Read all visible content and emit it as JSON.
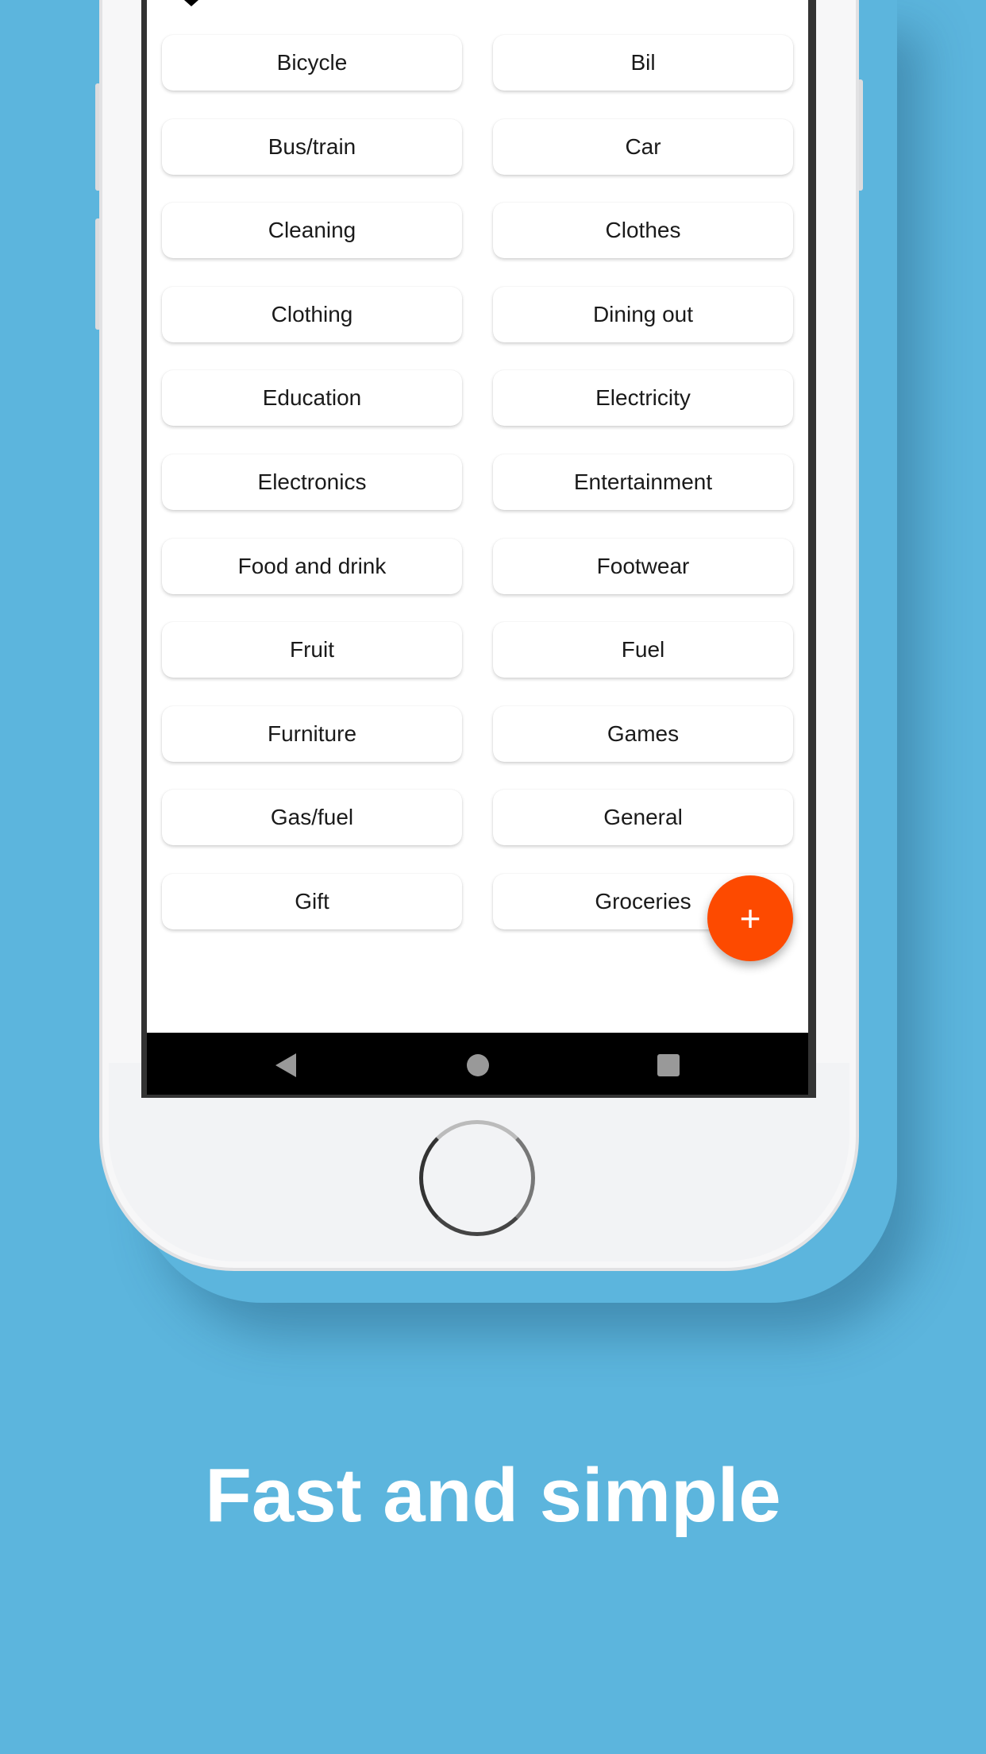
{
  "categories": [
    "Bicycle",
    "Bil",
    "Bus/train",
    "Car",
    "Cleaning",
    "Clothes",
    "Clothing",
    "Dining out",
    "Education",
    "Electricity",
    "Electronics",
    "Entertainment",
    "Food and drink",
    "Footwear",
    "Fruit",
    "Fuel",
    "Furniture",
    "Games",
    "Gas/fuel",
    "General",
    "Gift",
    "Groceries"
  ],
  "fab": {
    "label": "+",
    "icon": "plus-icon"
  },
  "navbar": {
    "icons": [
      "back-icon",
      "home-icon",
      "recents-icon"
    ]
  },
  "tagline": "Fast and simple",
  "colors": {
    "background": "#5cb5dd",
    "fab": "#fd4a00",
    "navbar": "#000000"
  }
}
